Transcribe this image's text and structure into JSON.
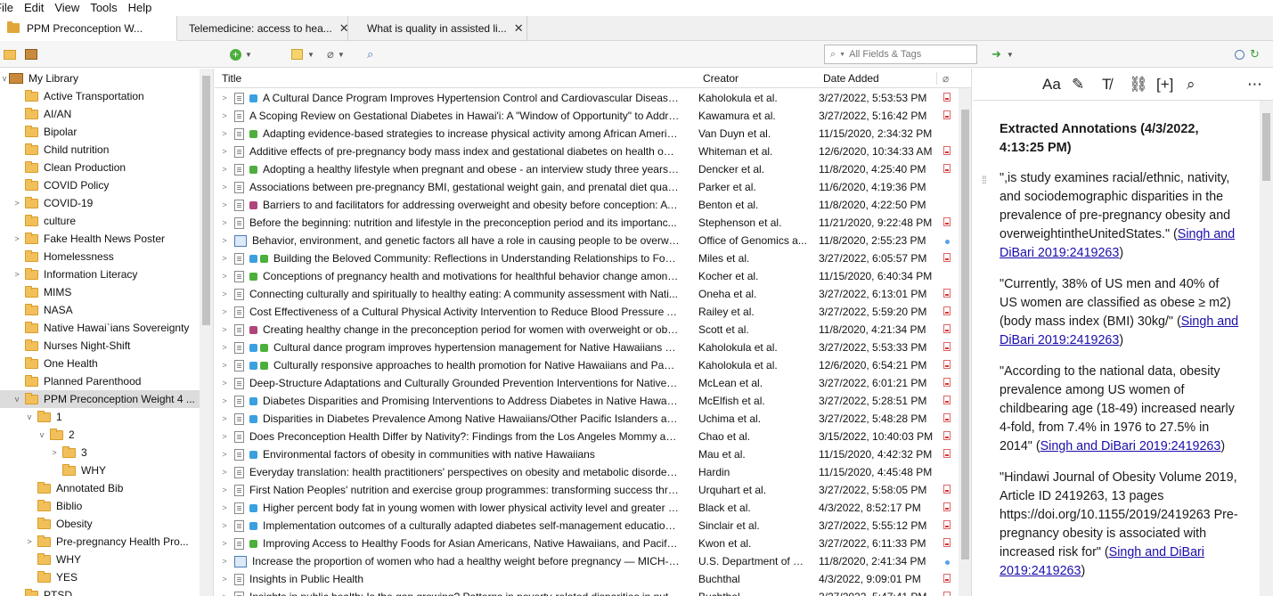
{
  "menu": [
    "File",
    "Edit",
    "View",
    "Tools",
    "Help"
  ],
  "tabs": [
    {
      "label": "PPM Preconception W...",
      "active": true
    },
    {
      "label": "Telemedicine: access to hea...",
      "active": false
    },
    {
      "label": "What is quality in assisted li...",
      "active": false
    }
  ],
  "search": {
    "placeholder": "All Fields & Tags"
  },
  "library": {
    "root": "My Library",
    "collections": [
      {
        "label": "Active Transportation",
        "indent": 1,
        "twisty": ""
      },
      {
        "label": "AI/AN",
        "indent": 1,
        "twisty": ""
      },
      {
        "label": "Bipolar",
        "indent": 1,
        "twisty": ""
      },
      {
        "label": "Child nutrition",
        "indent": 1,
        "twisty": ""
      },
      {
        "label": "Clean Production",
        "indent": 1,
        "twisty": ""
      },
      {
        "label": "COVID Policy",
        "indent": 1,
        "twisty": ""
      },
      {
        "label": "COVID-19",
        "indent": 1,
        "twisty": ">"
      },
      {
        "label": "culture",
        "indent": 1,
        "twisty": ""
      },
      {
        "label": "Fake Health News Poster",
        "indent": 1,
        "twisty": ">"
      },
      {
        "label": "Homelessness",
        "indent": 1,
        "twisty": ""
      },
      {
        "label": "Information Literacy",
        "indent": 1,
        "twisty": ">"
      },
      {
        "label": "MIMS",
        "indent": 1,
        "twisty": ""
      },
      {
        "label": "NASA",
        "indent": 1,
        "twisty": ""
      },
      {
        "label": "Native Hawai`ians Sovereignty",
        "indent": 1,
        "twisty": ""
      },
      {
        "label": "Nurses Night-Shift",
        "indent": 1,
        "twisty": ""
      },
      {
        "label": "One Health",
        "indent": 1,
        "twisty": ""
      },
      {
        "label": "Planned Parenthood",
        "indent": 1,
        "twisty": ""
      },
      {
        "label": "PPM Preconception Weight 4 ...",
        "indent": 1,
        "twisty": "v",
        "selected": true
      },
      {
        "label": "1",
        "indent": 2,
        "twisty": "v"
      },
      {
        "label": "2",
        "indent": 3,
        "twisty": "v"
      },
      {
        "label": "3",
        "indent": 4,
        "twisty": ">"
      },
      {
        "label": "WHY",
        "indent": 4,
        "twisty": ""
      },
      {
        "label": "Annotated Bib",
        "indent": 2,
        "twisty": ""
      },
      {
        "label": "Biblio",
        "indent": 2,
        "twisty": ""
      },
      {
        "label": "Obesity",
        "indent": 2,
        "twisty": ""
      },
      {
        "label": "Pre-pregnancy Health Pro...",
        "indent": 2,
        "twisty": ">"
      },
      {
        "label": "WHY",
        "indent": 2,
        "twisty": ""
      },
      {
        "label": "YES",
        "indent": 2,
        "twisty": ""
      },
      {
        "label": "PTSD",
        "indent": 1,
        "twisty": ""
      }
    ]
  },
  "columns": {
    "title": "Title",
    "creator": "Creator",
    "date_added": "Date Added"
  },
  "items": [
    {
      "tags": [
        "#3aa0e0"
      ],
      "title": "A Cultural Dance Program Improves Hypertension Control and Cardiovascular Disease Ri...",
      "creator": "Kaholokula et al.",
      "date": "3/27/2022, 5:53:53 PM",
      "att": "pdf",
      "icon": "doc"
    },
    {
      "tags": [],
      "title": "A Scoping Review on Gestational Diabetes in Hawai'i: A \"Window of Opportunity\" to Addre...",
      "creator": "Kawamura et al.",
      "date": "3/27/2022, 5:16:42 PM",
      "att": "pdf",
      "icon": "doc"
    },
    {
      "tags": [
        "#4caf3c"
      ],
      "title": "Adapting evidence-based strategies to increase physical activity among African America...",
      "creator": "Van Duyn et al.",
      "date": "11/15/2020, 2:34:32 PM",
      "att": "",
      "icon": "doc"
    },
    {
      "tags": [],
      "title": "Additive effects of pre-pregnancy body mass index and gestational diabetes on health outc...",
      "creator": "Whiteman et al.",
      "date": "12/6/2020, 10:34:33 AM",
      "att": "pdf",
      "icon": "doc"
    },
    {
      "tags": [
        "#4caf3c"
      ],
      "title": "Adopting a healthy lifestyle when pregnant and obese - an interview study three years aft...",
      "creator": "Dencker et al.",
      "date": "11/8/2020, 4:25:40 PM",
      "att": "pdf",
      "icon": "doc"
    },
    {
      "tags": [],
      "title": "Associations between pre-pregnancy BMI, gestational weight gain, and prenatal diet qualit...",
      "creator": "Parker et al.",
      "date": "11/6/2020, 4:19:36 PM",
      "att": "",
      "icon": "doc"
    },
    {
      "tags": [
        "#b0457a"
      ],
      "title": "Barriers to and facilitators for addressing overweight and obesity before conception: A q...",
      "creator": "Benton et al.",
      "date": "11/8/2020, 4:22:50 PM",
      "att": "",
      "icon": "doc"
    },
    {
      "tags": [],
      "title": "Before the beginning: nutrition and lifestyle in the preconception period and its importanc...",
      "creator": "Stephenson et al.",
      "date": "11/21/2020, 9:22:48 PM",
      "att": "pdf",
      "icon": "doc"
    },
    {
      "tags": [],
      "title": "Behavior, environment, and genetic factors all have a role in causing people to be overweig...",
      "creator": "Office of Genomics a...",
      "date": "11/8/2020, 2:55:23 PM",
      "att": "link",
      "icon": "web"
    },
    {
      "tags": [
        "#3aa0e0",
        "#4caf3c"
      ],
      "title": "Building the Beloved Community: Reflections in Understanding Relationships to Food ...",
      "creator": "Miles et al.",
      "date": "3/27/2022, 6:05:57 PM",
      "att": "pdf",
      "icon": "doc"
    },
    {
      "tags": [
        "#4caf3c"
      ],
      "title": "Conceptions of pregnancy health and motivations for healthful behavior change among ...",
      "creator": "Kocher et al.",
      "date": "11/15/2020, 6:40:34 PM",
      "att": "",
      "icon": "doc"
    },
    {
      "tags": [],
      "title": "Connecting culturally and spiritually to healthy eating: A community assessment with Nati...",
      "creator": "Oneha et al.",
      "date": "3/27/2022, 6:13:01 PM",
      "att": "pdf",
      "icon": "doc"
    },
    {
      "tags": [],
      "title": "Cost Effectiveness of a Cultural Physical Activity Intervention to Reduce Blood Pressure Am...",
      "creator": "Railey et al.",
      "date": "3/27/2022, 5:59:20 PM",
      "att": "pdf",
      "icon": "doc"
    },
    {
      "tags": [
        "#b0457a"
      ],
      "title": "Creating healthy change in the preconception period for women with overweight or obe...",
      "creator": "Scott et al.",
      "date": "11/8/2020, 4:21:34 PM",
      "att": "pdf",
      "icon": "doc"
    },
    {
      "tags": [
        "#3aa0e0",
        "#4caf3c"
      ],
      "title": "Cultural dance program improves hypertension management for Native Hawaiians an...",
      "creator": "Kaholokula et al.",
      "date": "3/27/2022, 5:53:33 PM",
      "att": "pdf",
      "icon": "doc"
    },
    {
      "tags": [
        "#3aa0e0",
        "#4caf3c"
      ],
      "title": "Culturally responsive approaches to health promotion for Native Hawaiians and Pacific...",
      "creator": "Kaholokula et al.",
      "date": "12/6/2020, 6:54:21 PM",
      "att": "pdf",
      "icon": "doc"
    },
    {
      "tags": [],
      "title": "Deep-Structure Adaptations and Culturally Grounded Prevention Interventions for Native H...",
      "creator": "McLean et al.",
      "date": "3/27/2022, 6:01:21 PM",
      "att": "pdf",
      "icon": "doc"
    },
    {
      "tags": [
        "#3aa0e0"
      ],
      "title": "Diabetes Disparities and Promising Interventions to Address Diabetes in Native Hawaiian ...",
      "creator": "McElfish et al.",
      "date": "3/27/2022, 5:28:51 PM",
      "att": "pdf",
      "icon": "doc"
    },
    {
      "tags": [
        "#3aa0e0"
      ],
      "title": "Disparities in Diabetes Prevalence Among Native Hawaiians/Other Pacific Islanders and A...",
      "creator": "Uchima et al.",
      "date": "3/27/2022, 5:48:28 PM",
      "att": "pdf",
      "icon": "doc"
    },
    {
      "tags": [],
      "title": "Does Preconception Health Differ by Nativity?: Findings from the Los Angeles Mommy and...",
      "creator": "Chao et al.",
      "date": "3/15/2022, 10:40:03 PM",
      "att": "pdf",
      "icon": "doc"
    },
    {
      "tags": [
        "#3aa0e0"
      ],
      "title": "Environmental factors of obesity in communities with native Hawaiians",
      "creator": "Mau et al.",
      "date": "11/15/2020, 4:42:32 PM",
      "att": "pdf",
      "icon": "doc"
    },
    {
      "tags": [],
      "title": "Everyday translation: health practitioners' perspectives on obesity and metabolic disorders i...",
      "creator": "Hardin",
      "date": "11/15/2020, 4:45:48 PM",
      "att": "",
      "icon": "doc"
    },
    {
      "tags": [],
      "title": "First Nation Peoples' nutrition and exercise group programmes: transforming success thro...",
      "creator": "Urquhart et al.",
      "date": "3/27/2022, 5:58:05 PM",
      "att": "pdf",
      "icon": "doc"
    },
    {
      "tags": [
        "#3aa0e0"
      ],
      "title": "Higher percent body fat in young women with lower physical activity level and greater pr...",
      "creator": "Black et al.",
      "date": "4/3/2022, 8:52:17 PM",
      "att": "pdf",
      "icon": "doc"
    },
    {
      "tags": [
        "#3aa0e0"
      ],
      "title": "Implementation outcomes of a culturally adapted diabetes self-management education i...",
      "creator": "Sinclair et al.",
      "date": "3/27/2022, 5:55:12 PM",
      "att": "pdf",
      "icon": "doc"
    },
    {
      "tags": [
        "#4caf3c"
      ],
      "title": "Improving Access to Healthy Foods for Asian Americans, Native Hawaiians, and Pacific Is...",
      "creator": "Kwon et al.",
      "date": "3/27/2022, 6:11:33 PM",
      "att": "pdf",
      "icon": "doc"
    },
    {
      "tags": [],
      "title": "Increase the proportion of women who had a healthy weight before pregnancy — MICH-13",
      "creator": "U.S. Department of H...",
      "date": "11/8/2020, 2:41:34 PM",
      "att": "link",
      "icon": "web"
    },
    {
      "tags": [],
      "title": "Insights in Public Health",
      "creator": "Buchthal",
      "date": "4/3/2022, 9:09:01 PM",
      "att": "pdf",
      "icon": "doc"
    },
    {
      "tags": [],
      "title": "Insights in public health: Is the gap growing? Patterns in poverty-related disparities in nut...",
      "creator": "Buchthal",
      "date": "3/27/2022, 5:47:41 PM",
      "att": "pdf",
      "icon": "doc"
    }
  ],
  "note": {
    "heading": "Extracted Annotations (4/3/2022, 4:13:25 PM)",
    "paragraphs": [
      {
        "text": "\",is study examines racial/ethnic, nativity, and sociodemographic disparities in the prevalence of pre-pregnancy obesity and overweightintheUnitedStates.\" (",
        "link": "Singh and DiBari 2019:2419263",
        "after": ")"
      },
      {
        "text": "\"Currently, 38% of US men and 40% of US women are classified as obese ≥ m2) (body mass index (BMI) 30kg/\" (",
        "link": "Singh and DiBari 2019:2419263",
        "after": ")"
      },
      {
        "text": "\"According to the national data, obesity prevalence among US women of childbearing age (18-49) increased nearly 4-fold, from 7.4% in 1976 to 27.5% in 2014\" (",
        "link": "Singh and DiBari 2019:2419263",
        "after": ")"
      },
      {
        "text": "\"Hindawi Journal of Obesity Volume 2019, Article ID 2419263, 13 pages https://doi.org/10.1155/2019/2419263 Pre-pregnancy obesity is associated with increased risk for\" (",
        "link": "Singh and DiBari 2019:2419263",
        "after": ")"
      }
    ]
  }
}
